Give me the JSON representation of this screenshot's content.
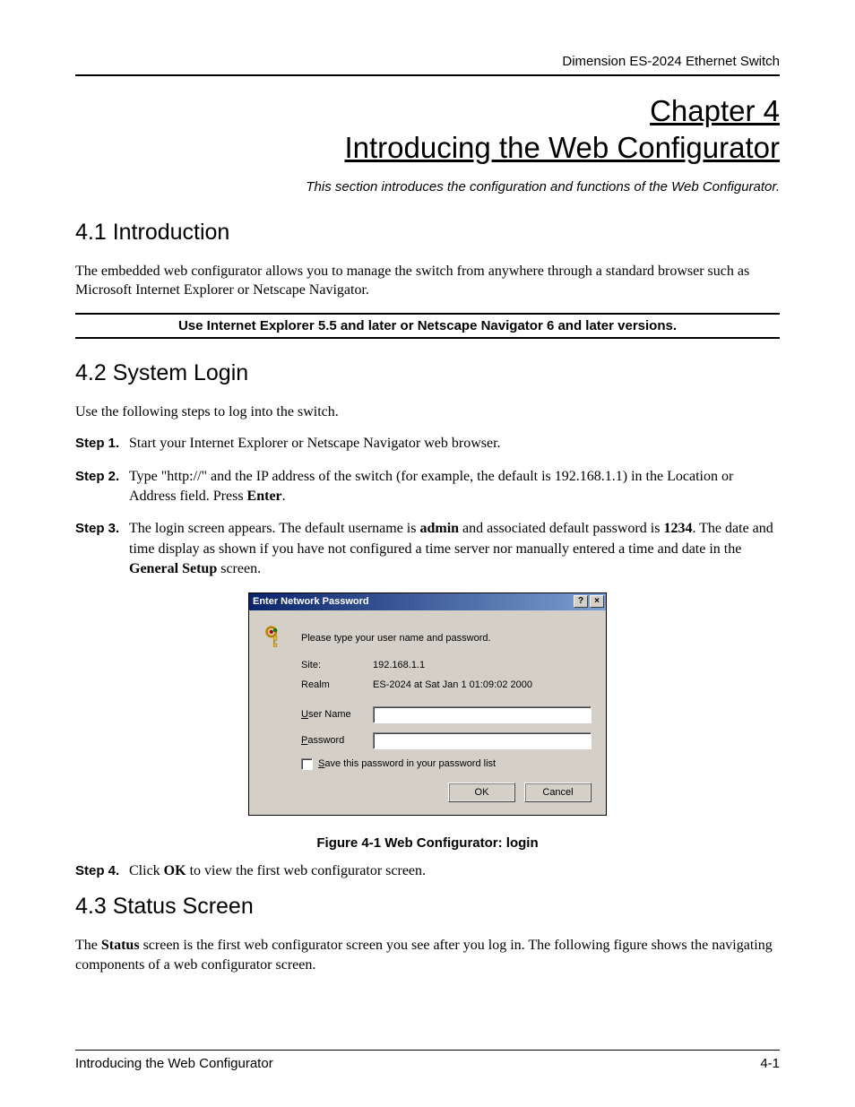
{
  "header": {
    "product": "Dimension ES-2024 Ethernet Switch"
  },
  "chapter": {
    "number_line": "Chapter 4",
    "title_line": "Introducing the Web Configurator",
    "intro": "This section introduces the configuration and functions of the Web Configurator."
  },
  "s41": {
    "heading": "4.1  Introduction",
    "para": "The embedded web configurator allows you to manage the switch from anywhere through a standard browser such as Microsoft Internet Explorer or Netscape Navigator.",
    "version_note": "Use Internet Explorer 5.5 and later or Netscape Navigator 6 and later versions."
  },
  "s42": {
    "heading": "4.2  System Login",
    "intro": "Use the following steps to log into the switch.",
    "steps": [
      {
        "label": "Step 1.",
        "body": "Start your Internet Explorer or Netscape Navigator web browser."
      },
      {
        "label": "Step 2.",
        "body_pre": "Type \"http://\" and the IP address of the switch (for example, the default is 192.168.1.1) in the Location or Address field. Press ",
        "body_bold": "Enter",
        "body_post": "."
      },
      {
        "label": "Step 3.",
        "body_pre": "The login screen appears. The default  username is ",
        "body_bold1": "admin",
        "body_mid": " and associated default password is ",
        "body_bold2": "1234",
        "body_mid2": ". The date and time display as shown if you have not configured a time server nor manually entered a time and date in the ",
        "body_bold3": "General Setup",
        "body_post": " screen."
      },
      {
        "label": "Step 4.",
        "body_pre": "Click ",
        "body_bold": "OK",
        "body_post": " to view the first web configurator screen."
      }
    ]
  },
  "dialog": {
    "title": "Enter Network Password",
    "help_btn": "?",
    "close_btn": "×",
    "prompt": "Please type your user name and password.",
    "site_label": "Site:",
    "site_value": "192.168.1.1",
    "realm_label": "Realm",
    "realm_value": "ES-2024 at Sat Jan  1 01:09:02 2000",
    "username_label_pre": "U",
    "username_label_rest": "ser Name",
    "password_label_pre": "P",
    "password_label_rest": "assword",
    "username_value": "",
    "password_value": "",
    "save_label_pre": "S",
    "save_label_rest": "ave this password in your password list",
    "ok": "OK",
    "cancel": "Cancel"
  },
  "figure_caption": "Figure 4-1 Web Configurator: login",
  "s43": {
    "heading": "4.3  Status Screen",
    "para_pre": "The ",
    "para_bold": "Status",
    "para_post": " screen is the first web configurator screen you see after you log in. The following figure shows the navigating components of a web configurator screen."
  },
  "footer": {
    "left": "Introducing the Web Configurator",
    "right": "4-1"
  }
}
